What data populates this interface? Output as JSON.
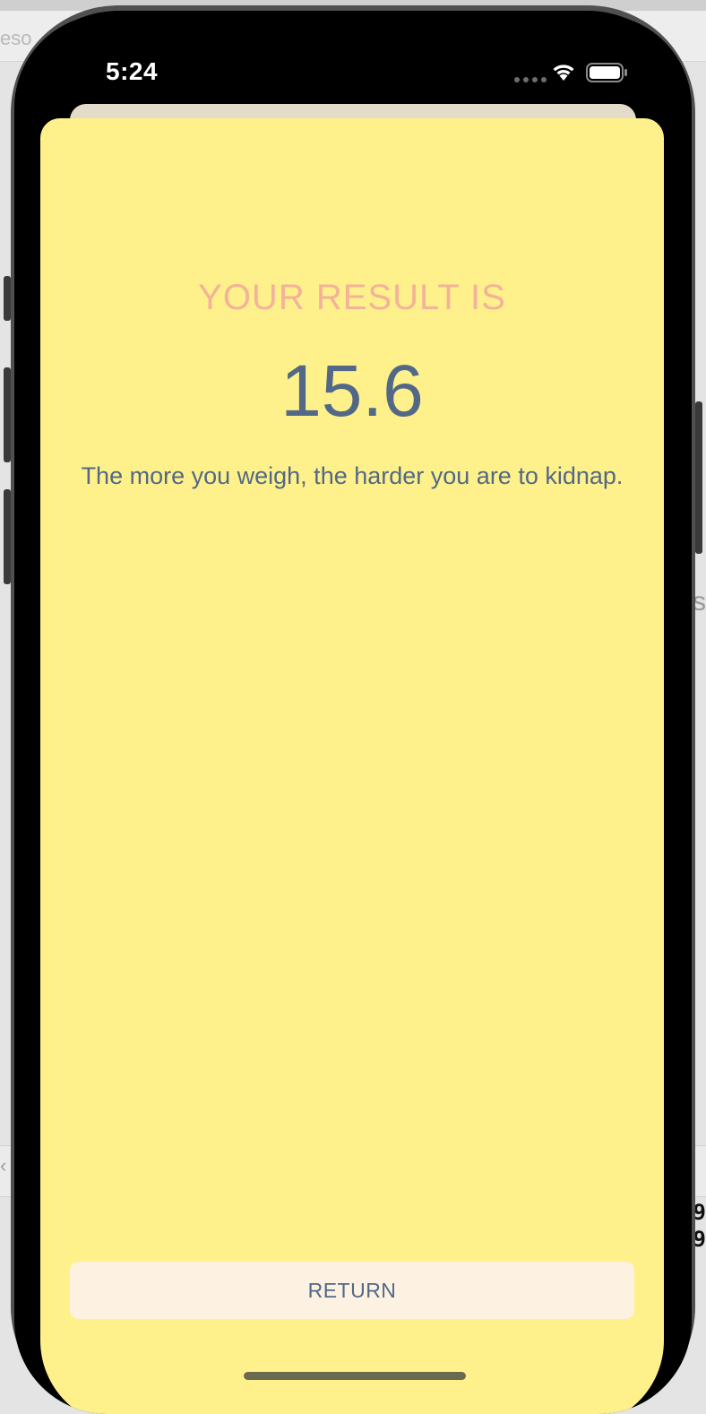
{
  "status_bar": {
    "time": "5:24",
    "wifi_icon": "wifi-icon",
    "battery_icon": "battery-icon"
  },
  "result": {
    "title": "YOUR RESULT IS",
    "value": "15.6",
    "message": "The more you weigh, the harder you are to kidnap."
  },
  "actions": {
    "return_label": "RETURN"
  },
  "colors": {
    "sheet_background": "#fef18b",
    "title": "#f3b299",
    "text": "#526886",
    "button_background": "#fdf2e2"
  }
}
